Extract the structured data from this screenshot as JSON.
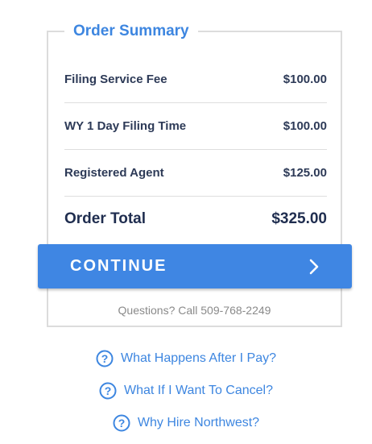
{
  "summary": {
    "title": "Order Summary",
    "items": [
      {
        "label": "Filing Service Fee",
        "amount": "$100.00"
      },
      {
        "label": "WY 1 Day Filing Time",
        "amount": "$100.00"
      },
      {
        "label": "Registered Agent",
        "amount": "$125.00"
      }
    ],
    "total_label": "Order Total",
    "total_amount": "$325.00"
  },
  "continue": {
    "label": "CONTINUE",
    "icon": "chevron-right-icon"
  },
  "contact": {
    "text": "Questions? Call 509-768-2249"
  },
  "faq": [
    {
      "label": "What Happens After I Pay?",
      "icon": "question-circle-icon"
    },
    {
      "label": "What If I Want To Cancel?",
      "icon": "question-circle-icon"
    },
    {
      "label": "Why Hire Northwest?",
      "icon": "question-circle-icon"
    }
  ],
  "colors": {
    "accent": "#3d86e0",
    "button": "#3f86e3",
    "text_dark": "#2d3a57",
    "muted": "#8a8a8a"
  }
}
